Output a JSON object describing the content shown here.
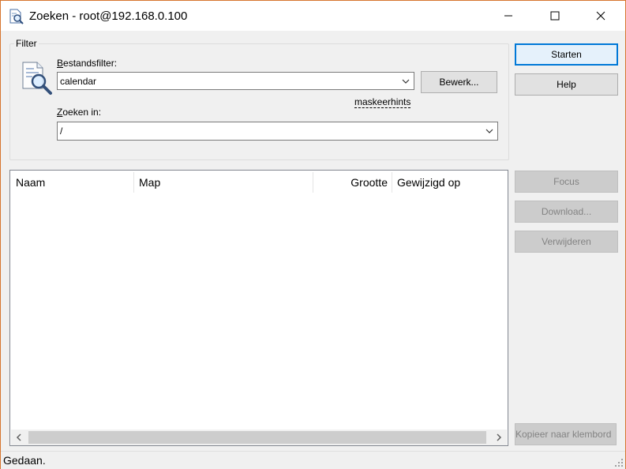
{
  "window": {
    "title": "Zoeken - root@192.168.0.100"
  },
  "filter": {
    "group_label": "Filter",
    "file_filter_label": "Bestandsfilter:",
    "file_filter_value": "calendar",
    "edit_button": "Bewerk...",
    "mask_hints_link": "maskeerhints",
    "search_in_label": "Zoeken in:",
    "search_in_value": "/"
  },
  "actions": {
    "start": "Starten",
    "help": "Help",
    "focus": "Focus",
    "download": "Download...",
    "delete": "Verwijderen",
    "copy_clipboard": "Kopieer naar klembord"
  },
  "results": {
    "columns": [
      "Naam",
      "Map",
      "Grootte",
      "Gewijzigd op"
    ],
    "rows": []
  },
  "status": {
    "text": "Gedaan."
  },
  "colors": {
    "accent": "#0078d7",
    "window_border": "#d6752e"
  }
}
